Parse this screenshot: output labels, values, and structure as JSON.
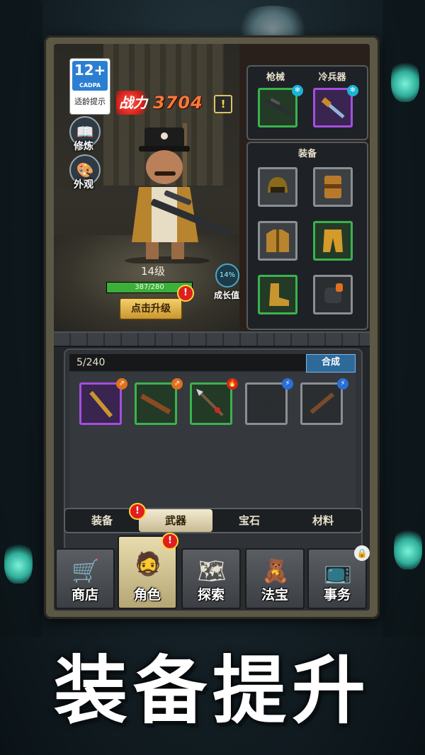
{
  "age_rating": {
    "label": "12+",
    "org": "CADPA",
    "tip": "适龄提示"
  },
  "side_buttons": [
    {
      "label": "修炼",
      "icon": "book-icon"
    },
    {
      "label": "外观",
      "icon": "palette-icon"
    }
  ],
  "power": {
    "icon_text": "战力",
    "value": "3704"
  },
  "hero": {
    "level": "14级",
    "hp": "387/280",
    "hp_fraction": 1.0,
    "upgrade_label": "点击升级"
  },
  "growth": {
    "percent": "14%",
    "label": "成长值"
  },
  "weapon_panel": {
    "tabs": [
      "枪械",
      "冷兵器"
    ]
  },
  "equip_panel": {
    "title": "装备"
  },
  "inventory": {
    "count": "5/240",
    "compose_label": "合成"
  },
  "tabs": [
    "装备",
    "武器",
    "宝石",
    "材料"
  ],
  "active_tab": "武器",
  "nav": [
    {
      "label": "商店",
      "icon": "shop-icon"
    },
    {
      "label": "角色",
      "icon": "character-icon"
    },
    {
      "label": "探索",
      "icon": "map-icon"
    },
    {
      "label": "法宝",
      "icon": "treasure-icon"
    },
    {
      "label": "事务",
      "icon": "tasks-icon"
    }
  ],
  "banner": "装备提升",
  "colors": {
    "power": "#f27a3a",
    "rare_green": "#3bb24e",
    "epic_purple": "#a44fe0",
    "hp": "#3cae3a"
  }
}
